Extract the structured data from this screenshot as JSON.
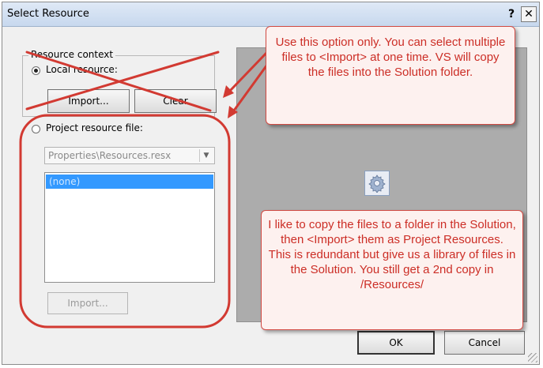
{
  "window": {
    "title": "Select Resource",
    "help_label": "?",
    "close_label": "✕"
  },
  "resource_context": {
    "group_label": "Resource context",
    "local_label": "Local resource:",
    "local_selected": true,
    "import_label": "Import...",
    "clear_label": "Clear"
  },
  "project": {
    "label": "Project resource file:",
    "combo_value": "Properties\\Resources.resx",
    "list_items": [
      "(none)"
    ],
    "import_label": "Import..."
  },
  "preview": {
    "icon": "gear-icon"
  },
  "footer": {
    "ok_label": "OK",
    "cancel_label": "Cancel"
  },
  "annotations": {
    "callout_top": "Use this option only.  You can select multiple files to <Import> at one time. VS will copy the files into the Solution folder.",
    "callout_bottom": "I like to copy the files to a folder in the Solution, then <Import> them as Project Resources. This is redundant but give us a library of files in the Solution.  You still get a 2nd copy in /Resources/",
    "annotation_color": "#d23a32"
  }
}
